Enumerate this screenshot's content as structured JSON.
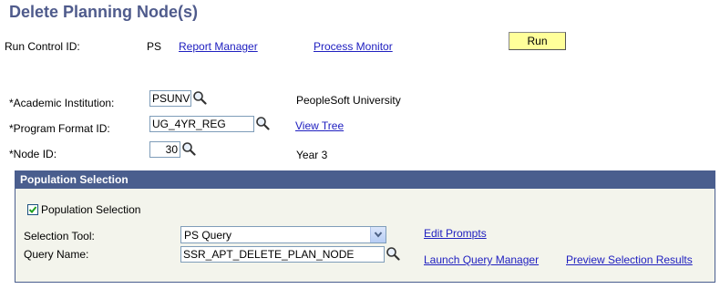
{
  "page": {
    "title": "Delete Planning Node(s)"
  },
  "run_control": {
    "label": "Run Control ID:",
    "value": "PS",
    "report_manager_link": "Report Manager",
    "process_monitor_link": "Process Monitor",
    "run_button": "Run"
  },
  "form": {
    "institution": {
      "label": "*Academic Institution:",
      "value": "PSUNV",
      "description": "PeopleSoft University"
    },
    "program_format": {
      "label": "*Program Format ID:",
      "value": "UG_4YR_REG",
      "link": "View Tree"
    },
    "node": {
      "label": "*Node ID:",
      "value": "30",
      "description": "Year 3"
    }
  },
  "population": {
    "header": "Population Selection",
    "checkbox_label": "Population Selection",
    "checked": true,
    "selection_tool_label": "Selection Tool:",
    "selection_tool_value": "PS Query",
    "query_name_label": "Query Name:",
    "query_name_value": "SSR_APT_DELETE_PLAN_NODE",
    "edit_prompts_link": "Edit Prompts",
    "launch_query_manager_link": "Launch Query Manager",
    "preview_results_link": "Preview Selection Results"
  },
  "icons": {
    "lookup": "magnifier-icon",
    "dropdown": "chevron-down-icon",
    "check": "checkmark-icon"
  },
  "colors": {
    "title": "#4f5b8c",
    "link": "#2020c0",
    "run_button": "#ffff9a",
    "panel_header": "#4a5e8e",
    "panel_bg": "#f3f4ec"
  }
}
